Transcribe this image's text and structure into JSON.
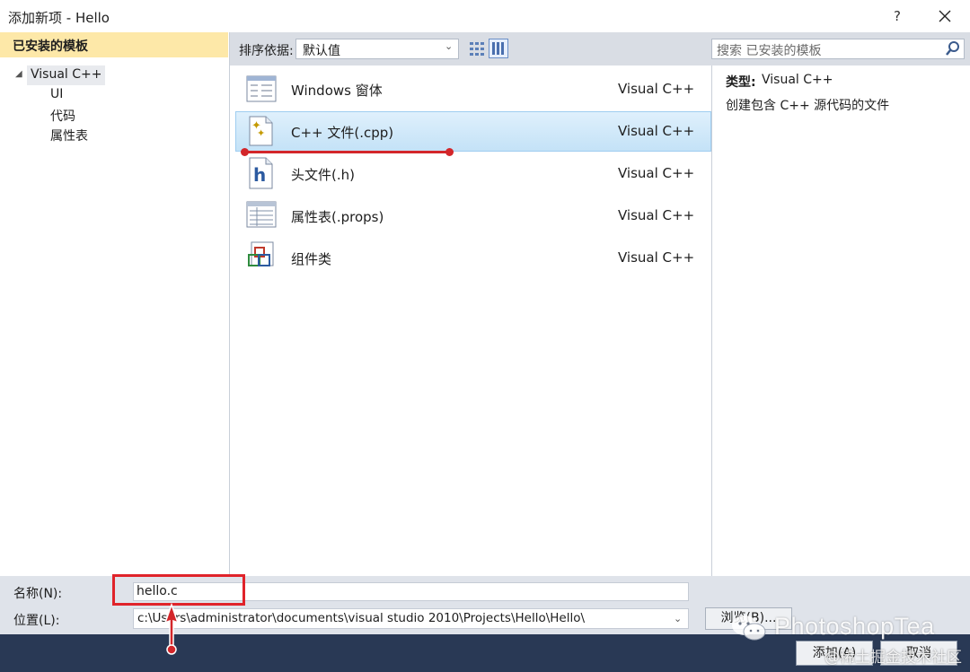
{
  "window": {
    "title": "添加新项 - Hello",
    "help": "?",
    "close_icon": "close-icon"
  },
  "sidebar": {
    "header": "已安装的模板",
    "tree": {
      "root": "Visual C++",
      "children": [
        "UI",
        "代码",
        "属性表"
      ]
    }
  },
  "toolbar": {
    "sort_label": "排序依据:",
    "sort_value": "默认值",
    "search_placeholder": "搜索 已安装的模板"
  },
  "templates": [
    {
      "name": "Windows 窗体",
      "lang": "Visual C++",
      "icon": "windows-form-icon",
      "selected": false
    },
    {
      "name": "C++ 文件(.cpp)",
      "lang": "Visual C++",
      "icon": "cpp-file-icon",
      "selected": true
    },
    {
      "name": "头文件(.h)",
      "lang": "Visual C++",
      "icon": "header-file-icon",
      "selected": false
    },
    {
      "name": "属性表(.props)",
      "lang": "Visual C++",
      "icon": "property-sheet-icon",
      "selected": false
    },
    {
      "name": "组件类",
      "lang": "Visual C++",
      "icon": "component-class-icon",
      "selected": false
    }
  ],
  "details": {
    "type_label": "类型:",
    "type_value": "Visual C++",
    "description": "创建包含 C++ 源代码的文件"
  },
  "form": {
    "name_label": "名称(N):",
    "name_value": "hello.c",
    "location_label": "位置(L):",
    "location_value": "c:\\Users\\administrator\\documents\\visual studio 2010\\Projects\\Hello\\Hello\\",
    "browse_label": "浏览(B)..."
  },
  "buttons": {
    "add": "添加(A)",
    "cancel": "取消"
  },
  "watermark": {
    "text": "PhotoshopTea",
    "sub": "@稀土掘金技术社区"
  },
  "colors": {
    "annotation_red": "#e0232a",
    "footer": "#293955",
    "selection": "#c4e2f7",
    "left_header": "#fde8a8"
  }
}
